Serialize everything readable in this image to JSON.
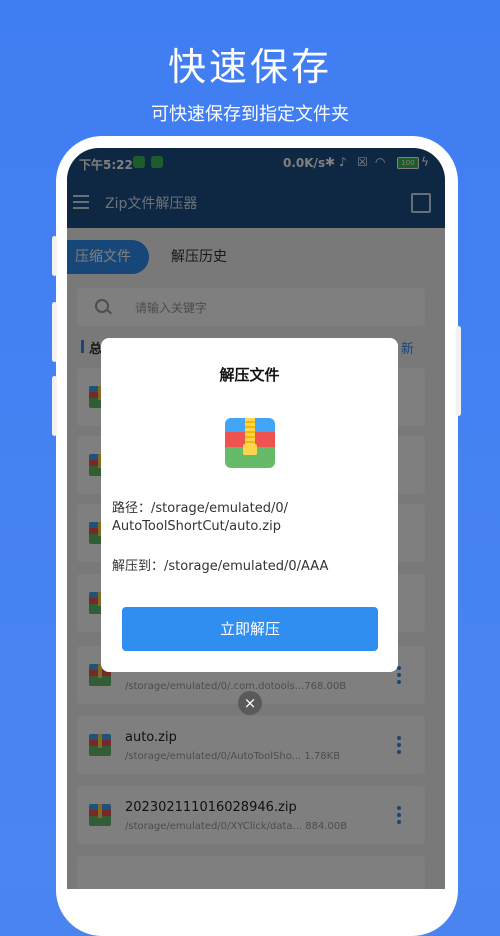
{
  "promo": {
    "title": "快速保存",
    "subtitle": "可快速保存到指定文件夹"
  },
  "status_bar": {
    "time": "下午5:22",
    "net_speed": "0.0K/s",
    "battery": "100"
  },
  "app_bar": {
    "title": "Zip文件解压器"
  },
  "tabs": [
    {
      "label": "压缩文件",
      "active": true
    },
    {
      "label": "解压历史",
      "active": false
    }
  ],
  "search": {
    "placeholder": "请输入关键字"
  },
  "summary": {
    "label_partial": "总",
    "refresh_partial": "新"
  },
  "files": [
    {
      "name": "",
      "path": ""
    },
    {
      "name": "",
      "path": ""
    },
    {
      "name": "",
      "path": ""
    },
    {
      "name": "",
      "path": ""
    },
    {
      "name": "",
      "path": "/storage/emulated/0/.com.dotools...768.00B"
    },
    {
      "name": "auto.zip",
      "path": "/storage/emulated/0/AutoToolSho... 1.78KB"
    },
    {
      "name": "20230211101602894​6.zip",
      "path": "/storage/emulated/0/XYClick/data... 884.00B"
    }
  ],
  "dialog": {
    "title": "解压文件",
    "path_label": "路径：/storage/emulated/0/",
    "path_value": "AutoToolShortCut/auto.zip",
    "dest": "解压到：/storage/emulated/0/AAA",
    "button": "立即解压",
    "close": "×"
  },
  "colors": {
    "accent": "#2f8ef0",
    "app_bar": "#1d4f86",
    "background": "#4a84f0"
  }
}
